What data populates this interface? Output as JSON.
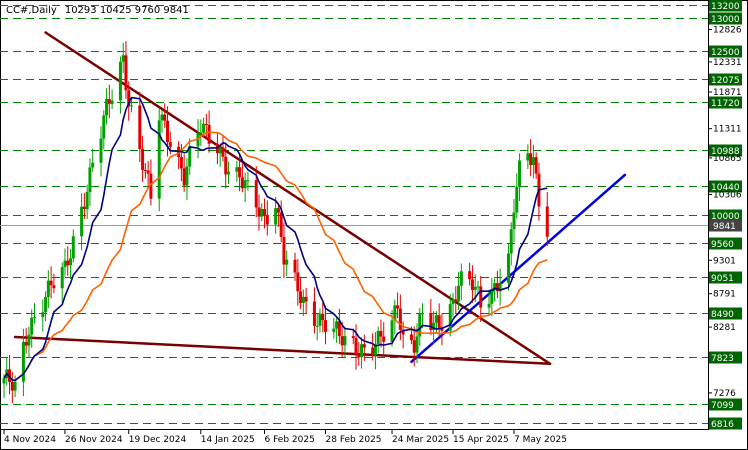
{
  "chart_data": {
    "type": "candlestick",
    "symbol": "CC#,Daily",
    "ohlc_text": "10293 10425 9760 9841",
    "current_price": "9841",
    "ylim": [
      6816,
      13200
    ],
    "price_tick_labels": [
      "12826",
      "12331",
      "11871",
      "11311",
      "10865",
      "10306",
      "9301",
      "8791",
      "8281",
      "7276"
    ],
    "x_tick_labels": [
      "4 Nov 2024",
      "26 Nov 2024",
      "19 Dec 2024",
      "14 Jan 2025",
      "6 Feb 2025",
      "28 Feb 2025",
      "24 Mar 2025",
      "15 Apr 2025",
      "7 May 2025"
    ],
    "level_labels": [
      "13200",
      "13000",
      "12500",
      "12075",
      "11720",
      "10988",
      "10440",
      "10000",
      "9560",
      "9051",
      "8490",
      "7823",
      "7099",
      "6816"
    ],
    "colors": {
      "bull_candle": "#00a000",
      "bear_candle": "#e00000",
      "ma_fast": "#000080",
      "ma_slow": "#ff6000",
      "trend_down": "#7a0000",
      "trend_up": "#0000e0",
      "level_line": "#008000",
      "level_box": "#006400",
      "current_box": "#444444"
    },
    "lines": [
      {
        "name": "descending resistance",
        "style": "trend_down",
        "points": [
          [
            "19 Nov 2024",
            12780
          ],
          [
            "20 May 2025",
            7720
          ]
        ]
      },
      {
        "name": "lower support",
        "style": "trend_down",
        "points": [
          [
            "8 Nov 2024",
            8130
          ],
          [
            "20 May 2025",
            7720
          ]
        ]
      },
      {
        "name": "ascending support",
        "style": "trend_up",
        "points": [
          [
            "31 Mar 2025",
            7750
          ],
          [
            "16 Jun 2025",
            10605
          ]
        ]
      }
    ]
  }
}
